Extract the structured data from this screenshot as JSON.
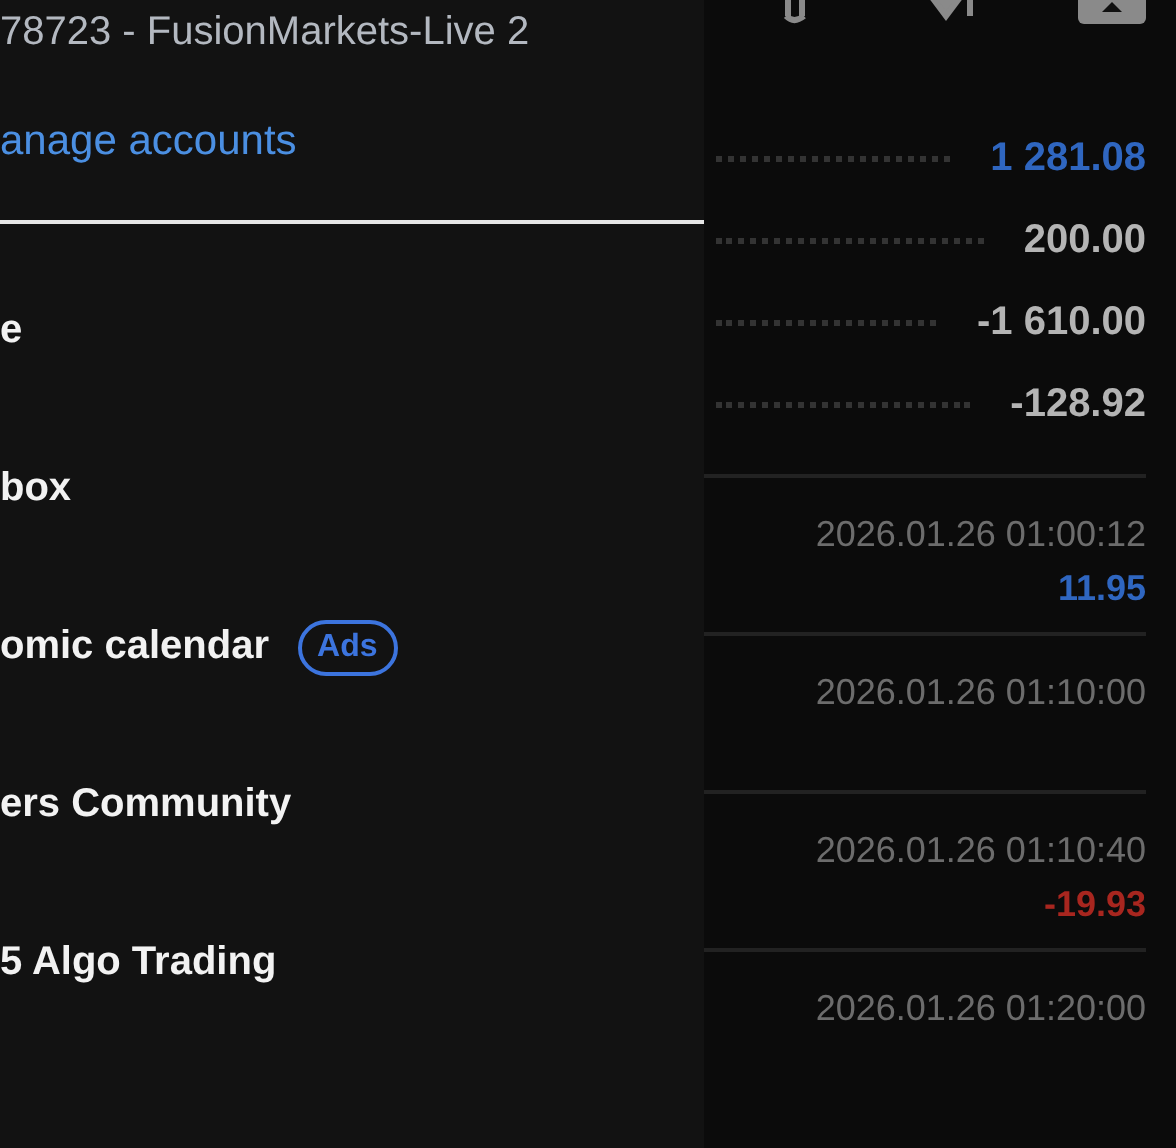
{
  "drawer": {
    "account": "78723 - FusionMarkets-Live 2",
    "manage_link": "anage accounts",
    "items": [
      {
        "label": "e"
      },
      {
        "label": "box"
      },
      {
        "label": "omic calendar",
        "badge": "Ads"
      },
      {
        "label": "ers Community"
      },
      {
        "label": "5 Algo Trading"
      }
    ]
  },
  "summary": [
    {
      "value": "1 281.08",
      "color": "#2f66c0"
    },
    {
      "value": "200.00",
      "color": "#b4b4b4"
    },
    {
      "value": "-1 610.00",
      "color": "#b4b4b4"
    },
    {
      "value": "-128.92",
      "color": "#b4b4b4"
    }
  ],
  "deals": [
    {
      "time": "2026.01.26 01:00:12",
      "profit": "11.95",
      "color": "#2f66c0"
    },
    {
      "time": "2026.01.26 01:10:00"
    },
    {
      "time": "2026.01.26 01:10:40",
      "profit": "-19.93",
      "color": "#a8261f"
    },
    {
      "time": "2026.01.26 01:20:00"
    }
  ]
}
